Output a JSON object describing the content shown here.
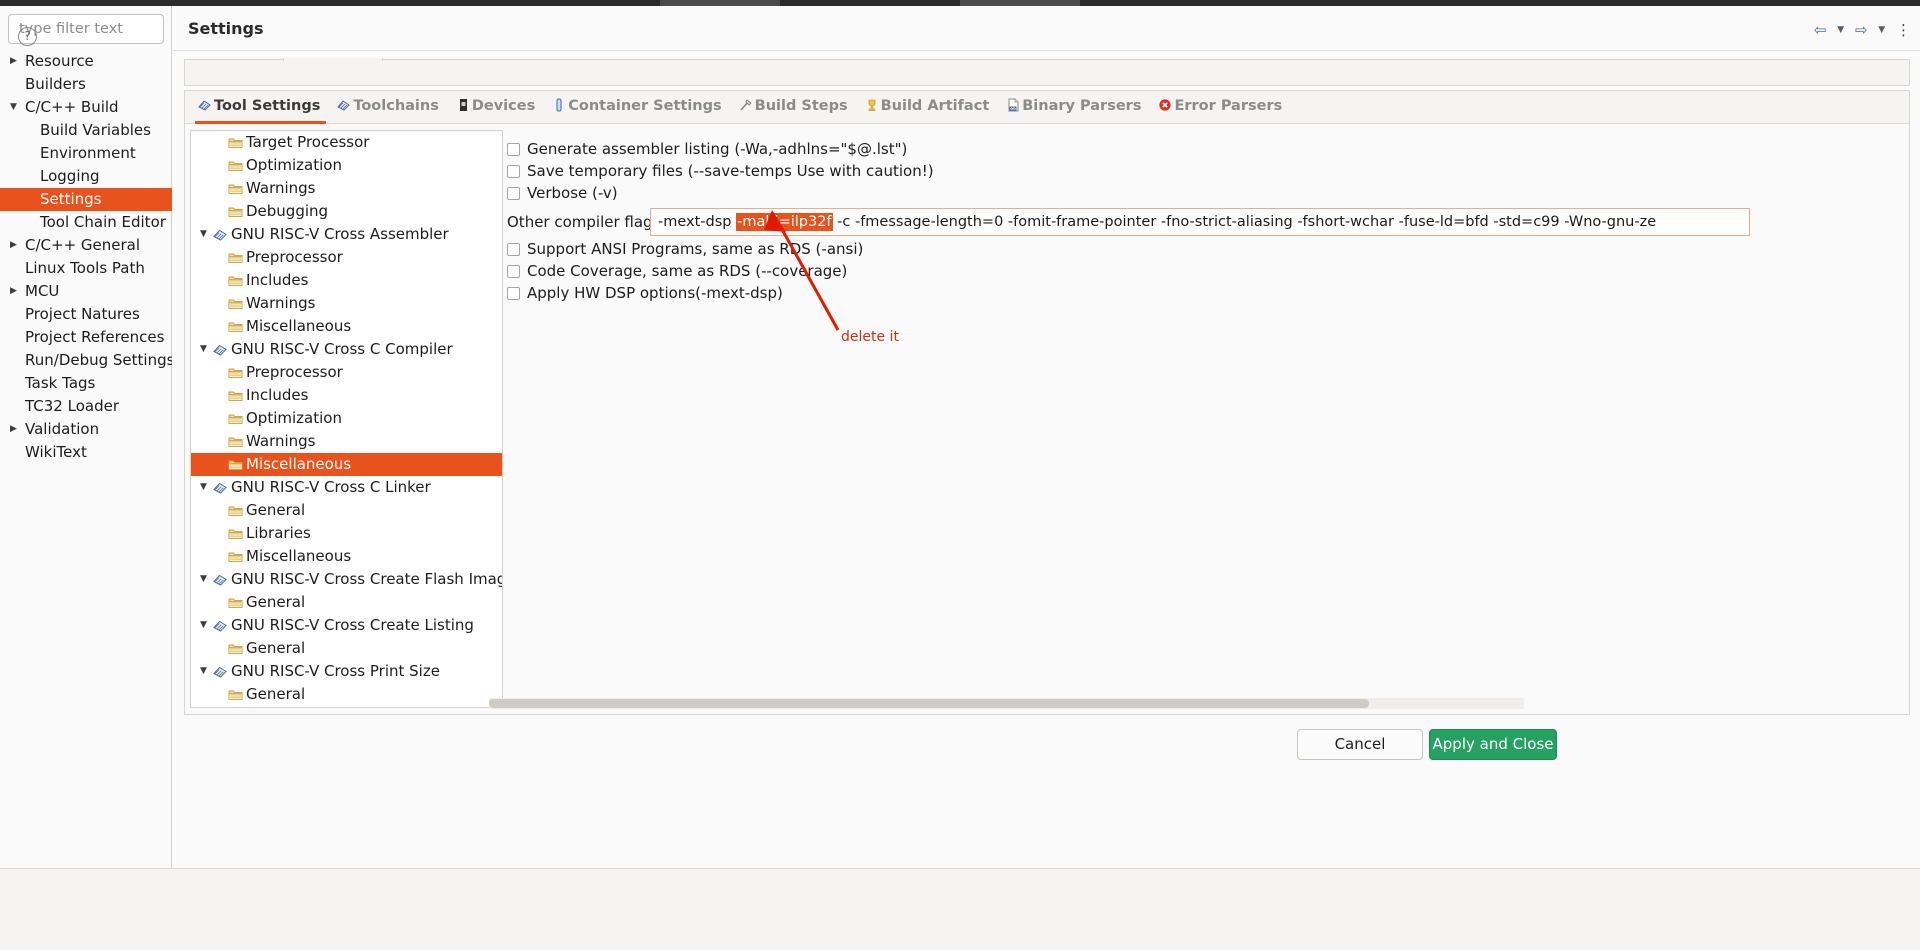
{
  "window": {
    "page_title": "Settings",
    "nav": {
      "back_icon": "back-arrow-icon",
      "back_menu_icon": "chevron-down-icon",
      "forward_icon": "forward-arrow-icon",
      "forward_menu_icon": "chevron-down-icon",
      "kebab_icon": "vertical-dots-icon"
    }
  },
  "sidebar": {
    "filter_placeholder": "type filter text",
    "filter_value": "",
    "items": [
      {
        "label": "Resource",
        "depth": 0,
        "arrow": "collapsed",
        "selected": false
      },
      {
        "label": "Builders",
        "depth": 0,
        "arrow": "none",
        "selected": false
      },
      {
        "label": "C/C++ Build",
        "depth": 0,
        "arrow": "expanded",
        "selected": false
      },
      {
        "label": "Build Variables",
        "depth": 1,
        "arrow": "none",
        "selected": false
      },
      {
        "label": "Environment",
        "depth": 1,
        "arrow": "none",
        "selected": false
      },
      {
        "label": "Logging",
        "depth": 1,
        "arrow": "none",
        "selected": false
      },
      {
        "label": "Settings",
        "depth": 1,
        "arrow": "none",
        "selected": true
      },
      {
        "label": "Tool Chain Editor",
        "depth": 1,
        "arrow": "none",
        "selected": false
      },
      {
        "label": "C/C++ General",
        "depth": 0,
        "arrow": "collapsed",
        "selected": false
      },
      {
        "label": "Linux Tools Path",
        "depth": 0,
        "arrow": "none",
        "selected": false
      },
      {
        "label": "MCU",
        "depth": 0,
        "arrow": "collapsed",
        "selected": false
      },
      {
        "label": "Project Natures",
        "depth": 0,
        "arrow": "none",
        "selected": false
      },
      {
        "label": "Project References",
        "depth": 0,
        "arrow": "none",
        "selected": false
      },
      {
        "label": "Run/Debug Settings",
        "depth": 0,
        "arrow": "none",
        "selected": false
      },
      {
        "label": "Task Tags",
        "depth": 0,
        "arrow": "none",
        "selected": false
      },
      {
        "label": "TC32 Loader",
        "depth": 0,
        "arrow": "none",
        "selected": false
      },
      {
        "label": "Validation",
        "depth": 0,
        "arrow": "collapsed",
        "selected": false
      },
      {
        "label": "WikiText",
        "depth": 0,
        "arrow": "none",
        "selected": false
      }
    ]
  },
  "tabs": [
    {
      "label": "Tool Settings",
      "icon": "tool-settings-icon",
      "active": true
    },
    {
      "label": "Toolchains",
      "icon": "toolchains-icon",
      "active": false
    },
    {
      "label": "Devices",
      "icon": "devices-icon",
      "active": false
    },
    {
      "label": "Container Settings",
      "icon": "container-settings-icon",
      "active": false
    },
    {
      "label": "Build Steps",
      "icon": "build-steps-icon",
      "active": false
    },
    {
      "label": "Build Artifact",
      "icon": "build-artifact-icon",
      "active": false
    },
    {
      "label": "Binary Parsers",
      "icon": "binary-parsers-icon",
      "active": false
    },
    {
      "label": "Error Parsers",
      "icon": "error-parsers-icon",
      "active": false
    }
  ],
  "tool_tree": [
    {
      "label": "Target Processor",
      "depth": 1,
      "arrow": "none",
      "folder": true,
      "selected": false
    },
    {
      "label": "Optimization",
      "depth": 1,
      "arrow": "none",
      "folder": true,
      "selected": false
    },
    {
      "label": "Warnings",
      "depth": 1,
      "arrow": "none",
      "folder": true,
      "selected": false
    },
    {
      "label": "Debugging",
      "depth": 1,
      "arrow": "none",
      "folder": true,
      "selected": false
    },
    {
      "label": "GNU RISC-V Cross Assembler",
      "depth": 0,
      "arrow": "expanded",
      "folder": false,
      "selected": false
    },
    {
      "label": "Preprocessor",
      "depth": 1,
      "arrow": "none",
      "folder": true,
      "selected": false
    },
    {
      "label": "Includes",
      "depth": 1,
      "arrow": "none",
      "folder": true,
      "selected": false
    },
    {
      "label": "Warnings",
      "depth": 1,
      "arrow": "none",
      "folder": true,
      "selected": false
    },
    {
      "label": "Miscellaneous",
      "depth": 1,
      "arrow": "none",
      "folder": true,
      "selected": false
    },
    {
      "label": "GNU RISC-V Cross C Compiler",
      "depth": 0,
      "arrow": "expanded",
      "folder": false,
      "selected": false
    },
    {
      "label": "Preprocessor",
      "depth": 1,
      "arrow": "none",
      "folder": true,
      "selected": false
    },
    {
      "label": "Includes",
      "depth": 1,
      "arrow": "none",
      "folder": true,
      "selected": false
    },
    {
      "label": "Optimization",
      "depth": 1,
      "arrow": "none",
      "folder": true,
      "selected": false
    },
    {
      "label": "Warnings",
      "depth": 1,
      "arrow": "none",
      "folder": true,
      "selected": false
    },
    {
      "label": "Miscellaneous",
      "depth": 1,
      "arrow": "none",
      "folder": true,
      "selected": true
    },
    {
      "label": "GNU RISC-V Cross C Linker",
      "depth": 0,
      "arrow": "expanded",
      "folder": false,
      "selected": false
    },
    {
      "label": "General",
      "depth": 1,
      "arrow": "none",
      "folder": true,
      "selected": false
    },
    {
      "label": "Libraries",
      "depth": 1,
      "arrow": "none",
      "folder": true,
      "selected": false
    },
    {
      "label": "Miscellaneous",
      "depth": 1,
      "arrow": "none",
      "folder": true,
      "selected": false
    },
    {
      "label": "GNU RISC-V Cross Create Flash Image",
      "depth": 0,
      "arrow": "expanded",
      "folder": false,
      "selected": false
    },
    {
      "label": "General",
      "depth": 1,
      "arrow": "none",
      "folder": true,
      "selected": false
    },
    {
      "label": "GNU RISC-V Cross Create Listing",
      "depth": 0,
      "arrow": "expanded",
      "folder": false,
      "selected": false
    },
    {
      "label": "General",
      "depth": 1,
      "arrow": "none",
      "folder": true,
      "selected": false
    },
    {
      "label": "GNU RISC-V Cross Print Size",
      "depth": 0,
      "arrow": "expanded",
      "folder": false,
      "selected": false
    },
    {
      "label": "General",
      "depth": 1,
      "arrow": "none",
      "folder": true,
      "selected": false
    }
  ],
  "settings_pane": {
    "checkboxes_top": [
      {
        "label": "Generate assembler listing (-Wa,-adhlns=\"$@.lst\")",
        "checked": false
      },
      {
        "label": "Save temporary files (--save-temps Use with caution!)",
        "checked": false
      },
      {
        "label": "Verbose (-v)",
        "checked": false
      }
    ],
    "flags": {
      "label": "Other compiler flags",
      "prefix": "-mext-dsp ",
      "highlighted": "-mabi=ilp32f",
      "suffix": " -c -fmessage-length=0 -fomit-frame-pointer -fno-strict-aliasing -fshort-wchar -fuse-ld=bfd -std=c99 -Wno-gnu-ze"
    },
    "checkboxes_bottom": [
      {
        "label": "Support ANSI Programs, same as RDS (-ansi)",
        "checked": false
      },
      {
        "label": "Code Coverage, same as RDS (--coverage)",
        "checked": false
      },
      {
        "label": "Apply HW DSP options(-mext-dsp)",
        "checked": false
      }
    ]
  },
  "annotation": {
    "text": "delete it",
    "color": "#e01b00"
  },
  "footer": {
    "help_label": "?",
    "cancel_label": "Cancel",
    "apply_label": "Apply and Close"
  },
  "colors": {
    "selection": "#e8521c",
    "apply_button": "#25a162",
    "annotation": "#e01b00"
  }
}
